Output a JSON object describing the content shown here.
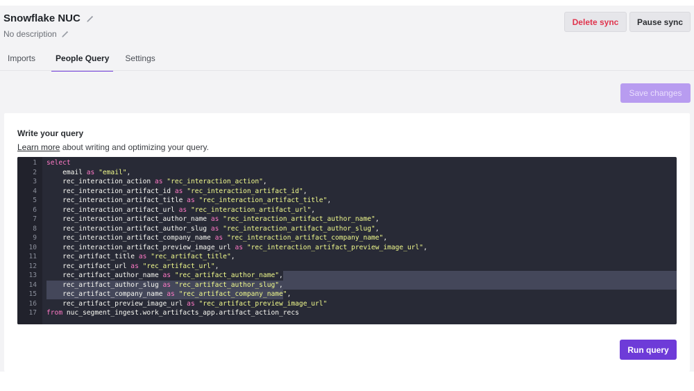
{
  "header": {
    "title": "Snowflake NUC",
    "description": "No description"
  },
  "actions": {
    "delete_label": "Delete sync",
    "pause_label": "Pause sync"
  },
  "tabs": [
    {
      "label": "Imports",
      "active": false
    },
    {
      "label": "People Query",
      "active": true
    },
    {
      "label": "Settings",
      "active": false
    }
  ],
  "save_label": "Save changes",
  "query": {
    "title": "Write your query",
    "help_link": "Learn more",
    "help_text": " about writing and optimizing your query.",
    "lines": [
      {
        "n": "1",
        "text": "select"
      },
      {
        "n": "2",
        "text": "    email as \"email\","
      },
      {
        "n": "3",
        "text": "    rec_interaction_action as \"rec_interaction_action\","
      },
      {
        "n": "4",
        "text": "    rec_interaction_artifact_id as \"rec_interaction_artifact_id\","
      },
      {
        "n": "5",
        "text": "    rec_interaction_artifact_title as \"rec_interaction_artifact_title\","
      },
      {
        "n": "6",
        "text": "    rec_interaction_artifact_url as \"rec_interaction_artifact_url\","
      },
      {
        "n": "7",
        "text": "    rec_interaction_artifact_author_name as \"rec_interaction_artifact_author_name\","
      },
      {
        "n": "8",
        "text": "    rec_interaction_artifact_author_slug as \"rec_interaction_artifact_author_slug\","
      },
      {
        "n": "9",
        "text": "    rec_interaction_artifact_company_name as \"rec_interaction_artifact_company_name\","
      },
      {
        "n": "10",
        "text": "    rec_interaction_artifact_preview_image_url as \"rec_interaction_artifact_preview_image_url\","
      },
      {
        "n": "11",
        "text": "    rec_artifact_title as \"rec_artifact_title\","
      },
      {
        "n": "12",
        "text": "    rec_artifact_url as \"rec_artifact_url\","
      },
      {
        "n": "13",
        "text": "    rec_artifact_author_name as \"rec_artifact_author_name\","
      },
      {
        "n": "14",
        "text": "    rec_artifact_author_slug as \"rec_artifact_author_slug\","
      },
      {
        "n": "15",
        "text": "    rec_artifact_company_name as \"rec_artifact_company_name\","
      },
      {
        "n": "16",
        "text": "    rec_artifact_preview_image_url as \"rec_artifact_preview_image_url\""
      },
      {
        "n": "17",
        "text": "from nuc_segment_ingest.work_artifacts_app.artifact_action_recs"
      }
    ],
    "run_label": "Run query"
  },
  "colors": {
    "accent": "#6e3bd8",
    "accent_disabled": "#b89cf0",
    "danger": "#e0344d",
    "editor_bg": "#282a36",
    "keyword": "#ff79c6",
    "string": "#f1fa8c",
    "selection": "#44475a"
  },
  "icons": {
    "title_edit": "pencil-icon",
    "description_edit": "pencil-icon"
  }
}
